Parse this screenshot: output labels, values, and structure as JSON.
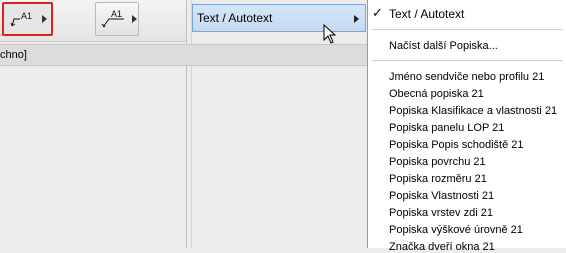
{
  "toolbar": {
    "label_btn1": "A1",
    "label_btn2": "A1"
  },
  "header": {
    "text": "chno]"
  },
  "parent_menu": {
    "label": "Text / Autotext"
  },
  "popup": {
    "checked_item": "Text / Autotext",
    "load_more": "Načíst další Popiska...",
    "items": [
      "Jméno sendviče nebo profilu 21",
      "Obecná popiska 21",
      "Popiska Klasifikace a vlastnosti 21",
      "Popiska panelu LOP 21",
      "Popiska Popis schodiště 21",
      "Popiska povrchu 21",
      "Popiska rozměru 21",
      "Popiska Vlastnosti 21",
      "Popiska vrstev zdi 21",
      "Popiska výškové úrovně 21",
      "Značka dveří okna 21"
    ]
  },
  "colors": {
    "highlight_border": "#e02020",
    "selection_bg": "#c4daf2"
  }
}
